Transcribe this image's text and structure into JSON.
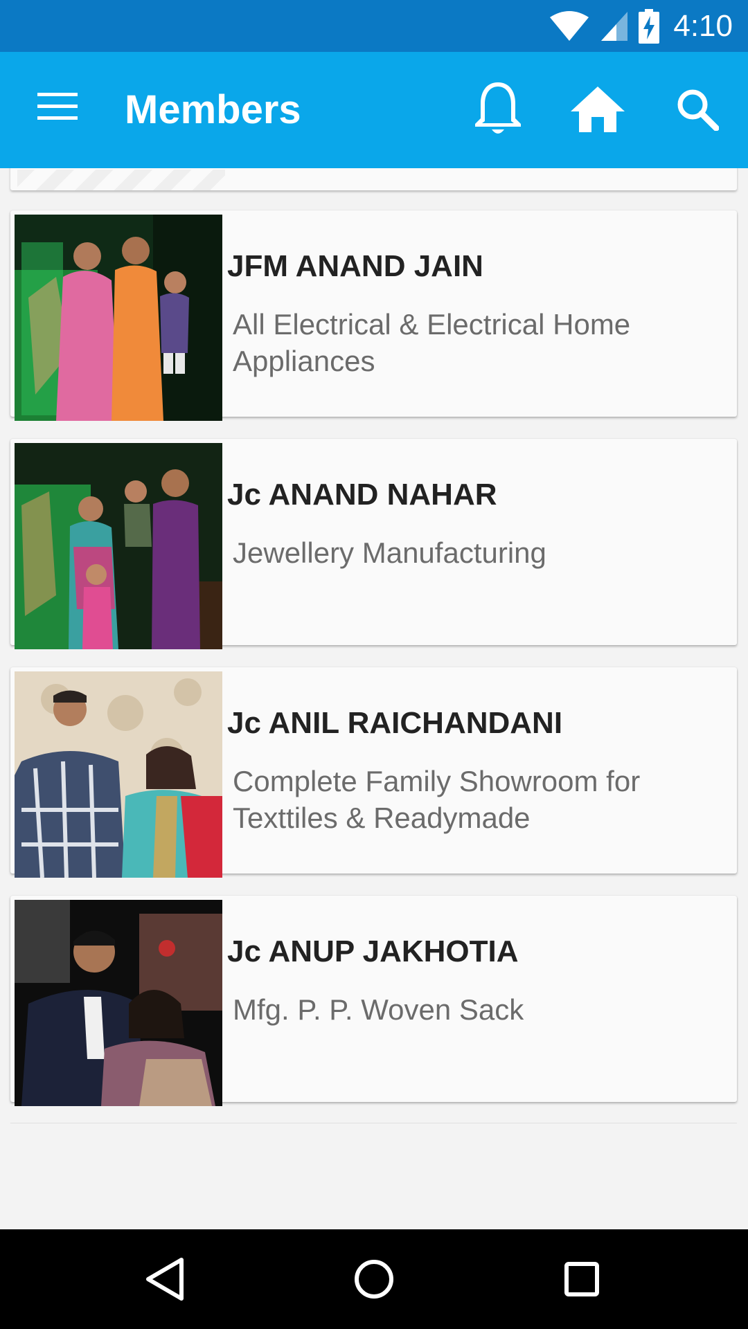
{
  "status_bar": {
    "time": "4:10",
    "icons": [
      "wifi-icon",
      "cell-signal-icon",
      "battery-charging-icon"
    ]
  },
  "app_bar": {
    "title": "Members",
    "icons": [
      "menu-icon",
      "bell-icon",
      "home-icon",
      "search-icon"
    ],
    "background_color": "#0aa7ea"
  },
  "members": [
    {
      "name": "JFM ANAND JAIN",
      "description": "All Electrical & Electrical Home Appliances"
    },
    {
      "name": "Jc ANAND NAHAR",
      "description": "Jewellery Manufacturing"
    },
    {
      "name": "Jc ANIL RAICHANDANI",
      "description": "Complete Family Showroom for Texttiles & Readymade"
    },
    {
      "name": "Jc ANUP JAKHOTIA",
      "description": "Mfg. P. P. Woven Sack"
    }
  ],
  "nav_bar": {
    "icons": [
      "back-icon",
      "home-circle-icon",
      "recents-icon"
    ]
  }
}
